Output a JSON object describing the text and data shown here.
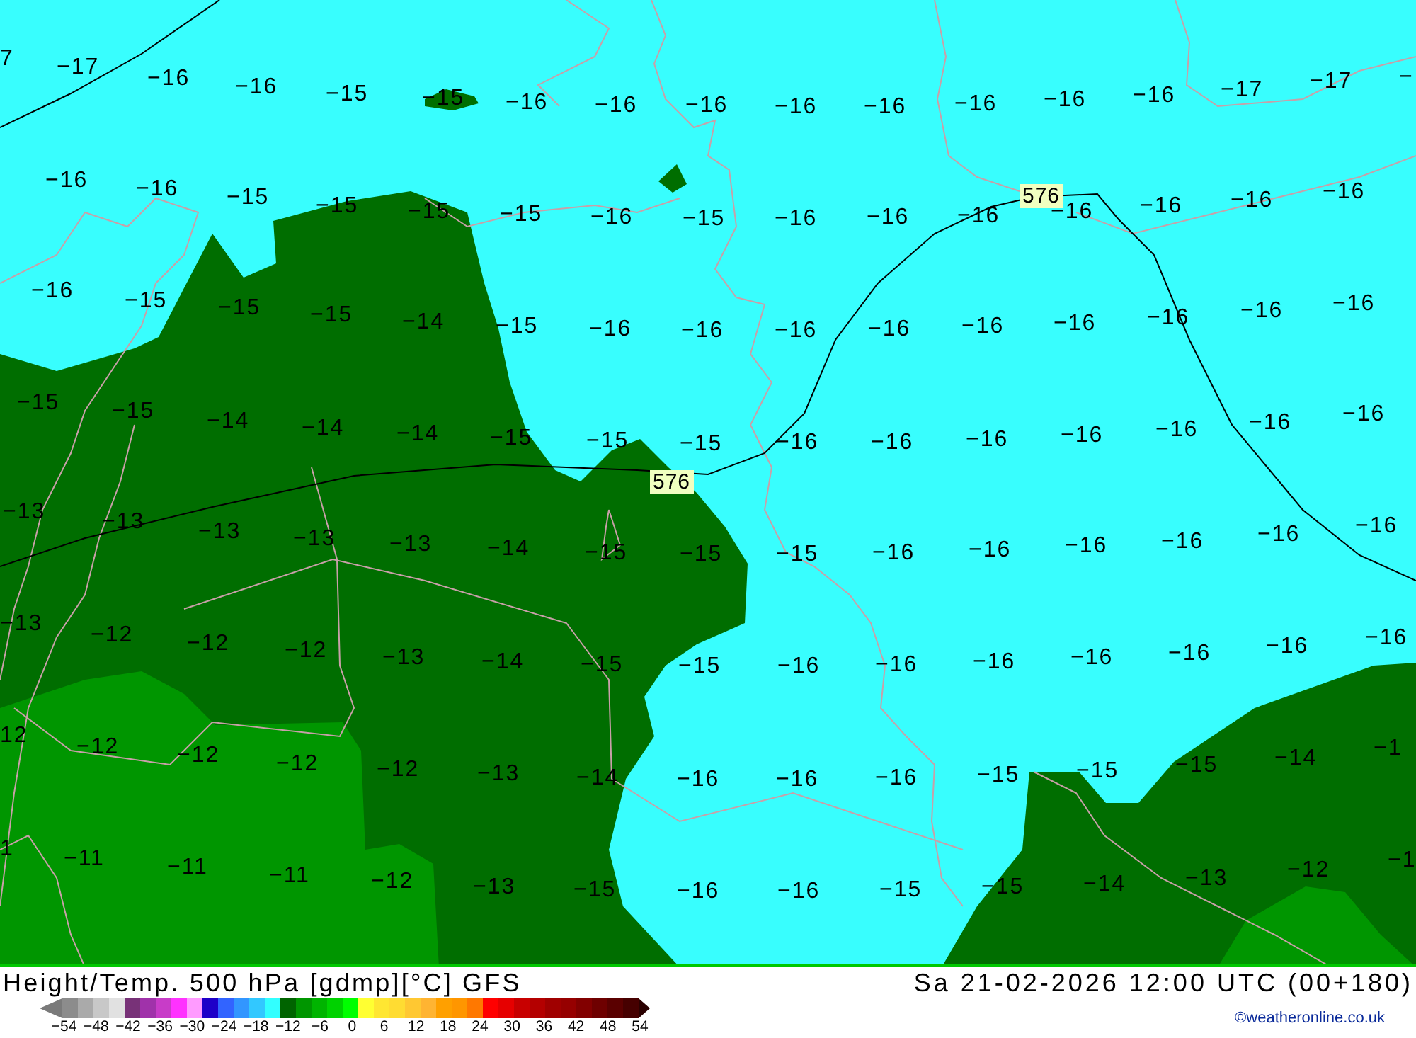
{
  "map": {
    "label_rows": [
      [
        "7",
        "−17",
        "−16",
        "−16",
        "−15",
        "−15",
        "−16",
        "−16",
        "−16",
        "−16",
        "−16",
        "−16",
        "−16",
        "−16",
        "−17",
        "−17",
        "−"
      ],
      [
        "−16",
        "−16",
        "−15",
        "−15",
        "−15",
        "−15",
        "−16",
        "−15",
        "−16",
        "−16",
        "−16",
        "−16",
        "−16",
        "−16",
        "−16"
      ],
      [
        "−16",
        "−15",
        "−15",
        "−15",
        "−14",
        "−15",
        "−16",
        "−16",
        "−16",
        "−16",
        "−16",
        "−16",
        "−16",
        "−16",
        "−16"
      ],
      [
        "−15",
        "−15",
        "−14",
        "−14",
        "−14",
        "−15",
        "−15",
        "−15",
        "−16",
        "−16",
        "−16",
        "−16",
        "−16",
        "−16",
        "−16"
      ],
      [
        "−13",
        "−13",
        "−13",
        "−13",
        "−13",
        "−14",
        "−15",
        "−15",
        "−15",
        "−16",
        "−16",
        "−16",
        "−16",
        "−16",
        "−16"
      ],
      [
        "−13",
        "−12",
        "−12",
        "−12",
        "−13",
        "−14",
        "−15",
        "−15",
        "−16",
        "−16",
        "−16",
        "−16",
        "−16",
        "−16",
        "−16"
      ],
      [
        "12",
        "−12",
        "−12",
        "−12",
        "−12",
        "−13",
        "−14",
        "−16",
        "−16",
        "−16",
        "−15",
        "−15",
        "−15",
        "−14",
        "−1"
      ],
      [
        "1",
        "−11",
        "−11",
        "−11",
        "−12",
        "−13",
        "−15",
        "−16",
        "−16",
        "−15",
        "−15",
        "−14",
        "−13",
        "−12",
        "−1"
      ]
    ],
    "contour_labels": [
      "576",
      "576"
    ]
  },
  "footer": {
    "title": "Height/Temp. 500 hPa [gdmp][°C] GFS",
    "valid_time": "Sa 21-02-2026 12:00 UTC (00+180)",
    "legend": {
      "swatches": [
        {
          "color": "#8c8c8c"
        },
        {
          "color": "#aaaaaa"
        },
        {
          "color": "#c8c8c8"
        },
        {
          "color": "#e1e1e1"
        },
        {
          "color": "#783278"
        },
        {
          "color": "#a032aa"
        },
        {
          "color": "#c83cc8"
        },
        {
          "color": "#ff32ff"
        },
        {
          "color": "#ff9bff"
        },
        {
          "color": "#1e00c8"
        },
        {
          "color": "#3264ff"
        },
        {
          "color": "#3296ff"
        },
        {
          "color": "#32c8ff"
        },
        {
          "color": "#32ffff"
        },
        {
          "color": "#006400"
        },
        {
          "color": "#009600"
        },
        {
          "color": "#00b400"
        },
        {
          "color": "#00d200"
        },
        {
          "color": "#00ff00"
        },
        {
          "color": "#ffff32"
        },
        {
          "color": "#ffe632"
        },
        {
          "color": "#ffdc32"
        },
        {
          "color": "#ffc832"
        },
        {
          "color": "#ffb432"
        },
        {
          "color": "#ffa000"
        },
        {
          "color": "#ff9600"
        },
        {
          "color": "#ff7800"
        },
        {
          "color": "#ff0000"
        },
        {
          "color": "#e60000"
        },
        {
          "color": "#c80000"
        },
        {
          "color": "#b40000"
        },
        {
          "color": "#a00000"
        },
        {
          "color": "#960000"
        },
        {
          "color": "#820000"
        },
        {
          "color": "#6e0000"
        },
        {
          "color": "#5a0000"
        },
        {
          "color": "#460000"
        }
      ],
      "ticks": [
        "−54",
        "−48",
        "−42",
        "−36",
        "−30",
        "−24",
        "−18",
        "−12",
        "−6",
        "0",
        "6",
        "12",
        "18",
        "24",
        "30",
        "36",
        "42",
        "48",
        "54"
      ]
    },
    "credit": "©weatheronline.co.uk"
  }
}
